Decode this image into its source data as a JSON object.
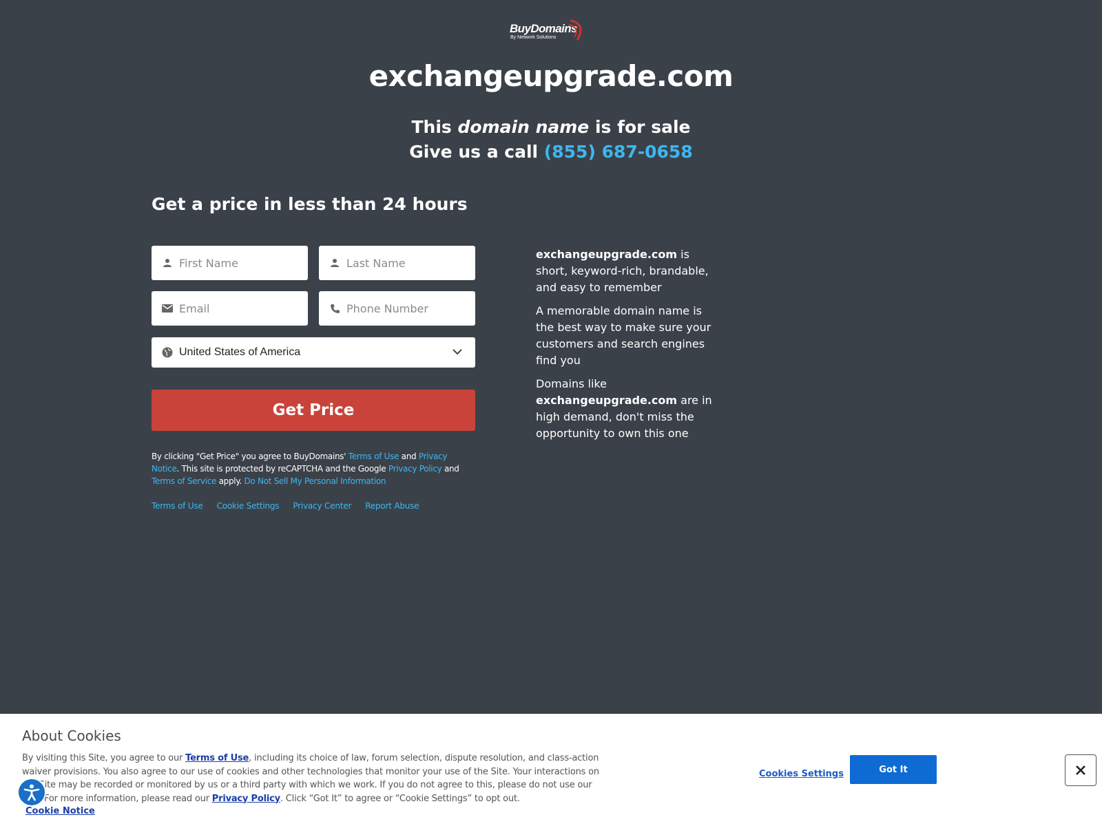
{
  "logo": {
    "brand": "BuyDomains",
    "sub": "By Network Solutions"
  },
  "domain": "exchangeupgrade.com",
  "hero": {
    "sale_prefix": "This ",
    "sale_em": "domain name",
    "sale_suffix": " is for sale",
    "call_prefix": "Give us a call ",
    "phone": "(855) 687-0658"
  },
  "form": {
    "heading": "Get a price in less than 24 hours",
    "first_name_placeholder": "First Name",
    "last_name_placeholder": "Last Name",
    "email_placeholder": "Email",
    "phone_placeholder": "Phone Number",
    "country_value": "United States of America",
    "submit_label": "Get Price"
  },
  "legal": {
    "line1_prefix": "By clicking \"Get Price\" you agree to BuyDomains' ",
    "terms_of_use": "Terms of Use",
    "and1": " and ",
    "privacy_notice": "Privacy Notice",
    "line1_suffix": ".",
    "line2_prefix": " This site is protected by reCAPTCHA and the Google ",
    "privacy_policy": "Privacy Policy",
    "and2": " and ",
    "terms_of_service": "Terms of Service",
    "apply": " apply. ",
    "do_not_sell": "Do Not Sell My Personal Information"
  },
  "footer_links": [
    "Terms of Use",
    "Cookie Settings",
    "Privacy Center",
    "Report Abuse"
  ],
  "pitch": {
    "p1_suffix": "  is short, keyword-rich, brandable, and easy to remember",
    "p2": "A memorable domain name is the best way to make sure your customers and search engines find you",
    "p3_prefix": "Domains like ",
    "p3_suffix": "  are in high demand, don't miss the opportunity to own this one"
  },
  "cookies": {
    "title": "About Cookies",
    "text_1": "By visiting this Site, you agree to our ",
    "terms_link": "Terms of Use",
    "text_2": ", including its choice of law, forum selection, dispute resolution, and class-action waiver provisions. You also agree to our use of cookies and other technologies that monitor your use of the Site. Your interactions on the Site may be recorded or monitored by us or a third party with which we work. If you do not agree to this, please do not use our Site. For more information, please read our ",
    "privacy_link": "Privacy Policy",
    "text_3": ". Click “Got It” to agree or “Cookie Settings” to opt out.",
    "notice_link": "Cookie Notice",
    "settings_label": "Cookies Settings",
    "got_it_label": "Got It"
  },
  "colors": {
    "background": "#3b4149",
    "accent_link": "#3db7f0",
    "cta": "#c9433a",
    "cookie_primary": "#0f6bd4"
  }
}
